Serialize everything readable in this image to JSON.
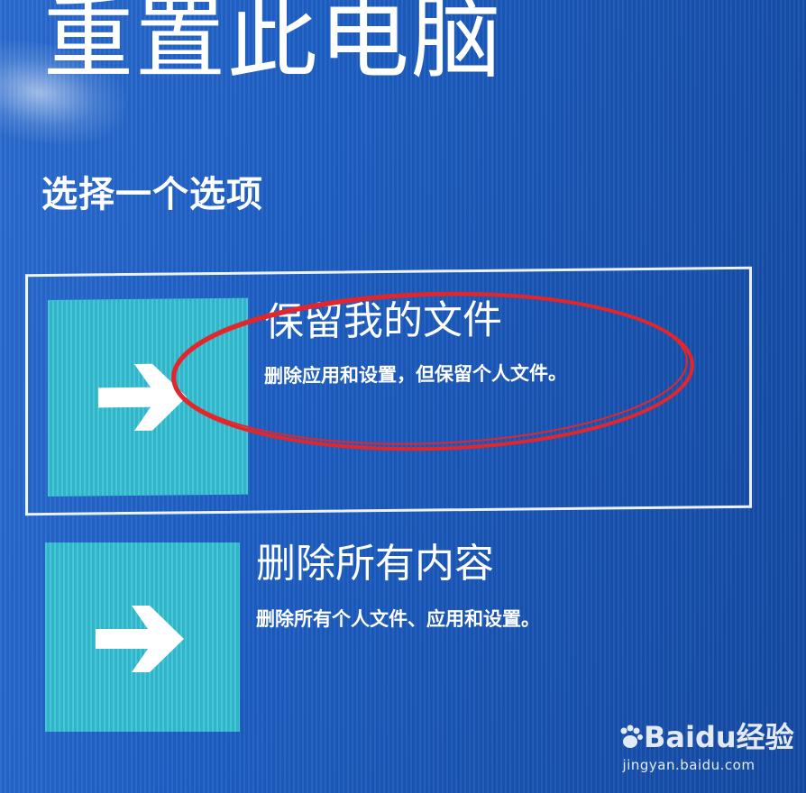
{
  "screen": {
    "title": "重置此电脑",
    "subtitle": "选择一个选项"
  },
  "options": [
    {
      "title": "保留我的文件",
      "description": "删除应用和设置，但保留个人文件。",
      "icon": "arrow-right-icon",
      "selected": true
    },
    {
      "title": "删除所有内容",
      "description": "删除所有个人文件、应用和设置。",
      "icon": "arrow-right-icon",
      "selected": false
    }
  ],
  "watermark": {
    "logo": "Baidu经验",
    "url": "jingyan.baidu.com"
  },
  "colors": {
    "background": "#1d5fc4",
    "tile": "#33bfd3",
    "annotation": "#e2262b",
    "text": "#ffffff"
  }
}
